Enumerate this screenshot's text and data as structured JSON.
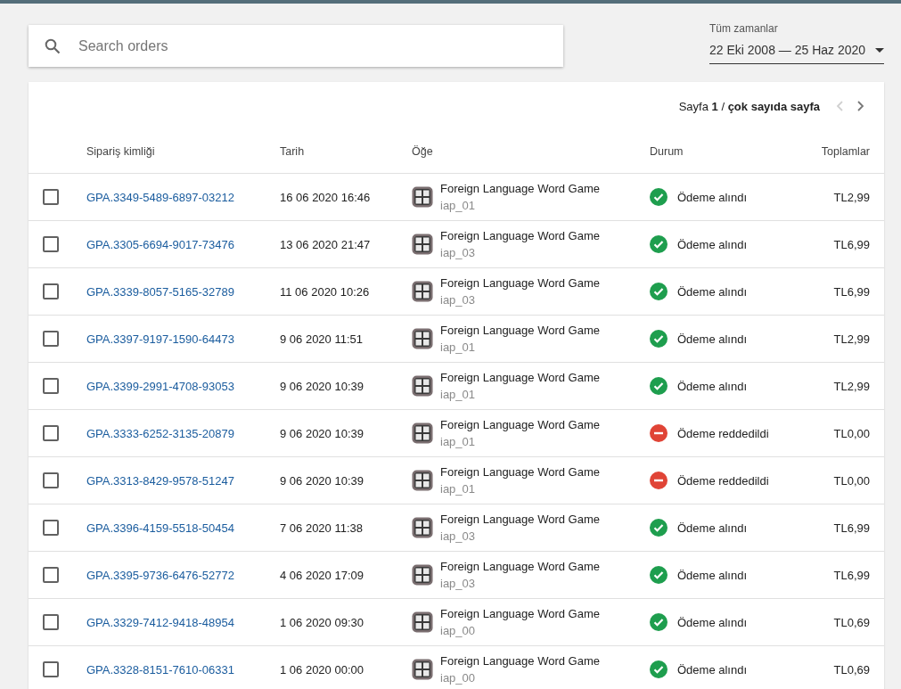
{
  "search": {
    "placeholder": "Search orders"
  },
  "date_filter": {
    "label": "Tüm zamanlar",
    "value": "22 Eki 2008 — 25 Haz 2020"
  },
  "pagination": {
    "text": "Sayfa **1** / **çok sayıda sayfa**",
    "previous_disabled": true,
    "next_disabled": false
  },
  "table": {
    "columns": [
      "Sipariş kimliği",
      "Tarih",
      "Öğe",
      "Durum",
      "Toplamlar"
    ],
    "rows": [
      {
        "checked": false,
        "order_id": "GPA.3349-5489-6897-03212",
        "date": "16 06 2020 16:46",
        "item": "Foreign Language Word Game",
        "sku": "iap_01",
        "kind": "paid",
        "status": "Ödeme alındı",
        "total": "TL2,99"
      },
      {
        "checked": false,
        "order_id": "GPA.3305-6694-9017-73476",
        "date": "13 06 2020 21:47",
        "item": "Foreign Language Word Game",
        "sku": "iap_03",
        "kind": "paid",
        "status": "Ödeme alındı",
        "total": "TL6,99"
      },
      {
        "checked": false,
        "order_id": "GPA.3339-8057-5165-32789",
        "date": "11 06 2020 10:26",
        "item": "Foreign Language Word Game",
        "sku": "iap_03",
        "kind": "paid",
        "status": "Ödeme alındı",
        "total": "TL6,99"
      },
      {
        "checked": false,
        "order_id": "GPA.3397-9197-1590-64473",
        "date": "9 06 2020 11:51",
        "item": "Foreign Language Word Game",
        "sku": "iap_01",
        "kind": "paid",
        "status": "Ödeme alındı",
        "total": "TL2,99"
      },
      {
        "checked": false,
        "order_id": "GPA.3399-2991-4708-93053",
        "date": "9 06 2020 10:39",
        "item": "Foreign Language Word Game",
        "sku": "iap_01",
        "kind": "paid",
        "status": "Ödeme alındı",
        "total": "TL2,99"
      },
      {
        "checked": false,
        "order_id": "GPA.3333-6252-3135-20879",
        "date": "9 06 2020 10:39",
        "item": "Foreign Language Word Game",
        "sku": "iap_01",
        "kind": "declined",
        "status": "Ödeme reddedildi",
        "total": "TL0,00"
      },
      {
        "checked": false,
        "order_id": "GPA.3313-8429-9578-51247",
        "date": "9 06 2020 10:39",
        "item": "Foreign Language Word Game",
        "sku": "iap_01",
        "kind": "declined",
        "status": "Ödeme reddedildi",
        "total": "TL0,00"
      },
      {
        "checked": false,
        "order_id": "GPA.3396-4159-5518-50454",
        "date": "7 06 2020 11:38",
        "item": "Foreign Language Word Game",
        "sku": "iap_03",
        "kind": "paid",
        "status": "Ödeme alındı",
        "total": "TL6,99"
      },
      {
        "checked": false,
        "order_id": "GPA.3395-9736-6476-52772",
        "date": "4 06 2020 17:09",
        "item": "Foreign Language Word Game",
        "sku": "iap_03",
        "kind": "paid",
        "status": "Ödeme alındı",
        "total": "TL6,99"
      },
      {
        "checked": false,
        "order_id": "GPA.3329-7412-9418-48954",
        "date": "1 06 2020 09:30",
        "item": "Foreign Language Word Game",
        "sku": "iap_00",
        "kind": "paid",
        "status": "Ödeme alındı",
        "total": "TL0,69"
      },
      {
        "checked": false,
        "order_id": "GPA.3328-8151-7610-06331",
        "date": "1 06 2020 00:00",
        "item": "Foreign Language Word Game",
        "sku": "iap_00",
        "kind": "paid",
        "status": "Ödeme alındı",
        "total": "TL0,69"
      }
    ]
  }
}
